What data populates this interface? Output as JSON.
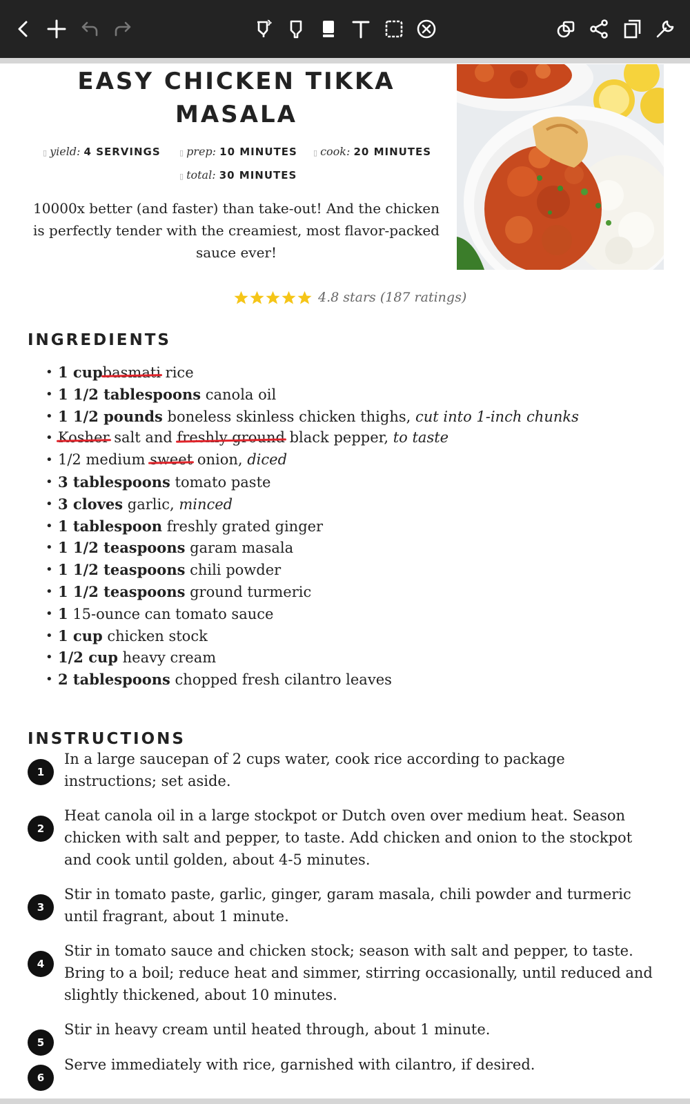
{
  "toolbar": {
    "left_icons": [
      "back-icon",
      "add-icon",
      "undo-icon",
      "redo-icon"
    ],
    "center_icons": [
      "pen-bluetooth-icon",
      "highlighter-icon",
      "eraser-icon",
      "text-icon",
      "lasso-select-icon",
      "clear-icon"
    ],
    "right_icons": [
      "shapes-icon",
      "share-icon",
      "pages-icon",
      "settings-wrench-icon"
    ],
    "background_color": "#232323"
  },
  "recipe": {
    "title_line1": "EASY CHICKEN TIKKA",
    "title_line2": "MASALA",
    "yield_label": "yield:",
    "yield_value": "4 SERVINGS",
    "prep_label": "prep:",
    "prep_value": "10 MINUTES",
    "cook_label": "cook:",
    "cook_value": "20 MINUTES",
    "total_label": "total:",
    "total_value": "30 MINUTES",
    "summary": "10000x better (and faster) than take-out! And the chicken is perfectly tender with the creamiest, most flavor-packed sauce ever!",
    "photo_alt_icon": "chicken-tikka-masala-photo",
    "rating": {
      "stars_shown": 5,
      "text": "4.8 stars (187 ratings)",
      "star_color": "#f5c518"
    }
  },
  "ingredients": {
    "heading": "INGREDIENTS",
    "items": [
      {
        "amount": "1 cup",
        "pre": "",
        "struck": "basmati",
        "text": " rice",
        "note": ""
      },
      {
        "amount": "1 1/2 tablespoons",
        "pre": "",
        "struck": "",
        "text": " canola oil",
        "note": ""
      },
      {
        "amount": "1 1/2 pounds",
        "pre": "",
        "struck": "",
        "text": " boneless skinless chicken thighs, ",
        "note": "cut into 1-inch chunks"
      },
      {
        "amount": "",
        "pre": "",
        "struck": "Kosher",
        "text": " salt and ",
        "struck2": "freshly ground",
        "text2": " black pepper, ",
        "note": "to taste"
      },
      {
        "amount": "",
        "pre": "1/2 medium ",
        "struck": "sweet",
        "text": " onion, ",
        "note": "diced"
      },
      {
        "amount": "3 tablespoons",
        "pre": "",
        "struck": "",
        "text": " tomato paste",
        "note": ""
      },
      {
        "amount": "3 cloves",
        "pre": "",
        "struck": "",
        "text": " garlic, ",
        "note": "minced"
      },
      {
        "amount": "1 tablespoon",
        "pre": "",
        "struck": "",
        "text": " freshly grated ginger",
        "note": ""
      },
      {
        "amount": "1 1/2 teaspoons",
        "pre": "",
        "struck": "",
        "text": " garam masala",
        "note": ""
      },
      {
        "amount": "1 1/2 teaspoons",
        "pre": "",
        "struck": "",
        "text": " chili powder",
        "note": ""
      },
      {
        "amount": "1 1/2 teaspoons",
        "pre": "",
        "struck": "",
        "text": " ground turmeric",
        "note": ""
      },
      {
        "amount": "1",
        "pre": "",
        "struck": "",
        "text": " 15-ounce can tomato sauce",
        "note": ""
      },
      {
        "amount": "1 cup",
        "pre": "",
        "struck": "",
        "text": " chicken stock",
        "note": ""
      },
      {
        "amount": "1/2 cup",
        "pre": "",
        "struck": "",
        "text": " heavy cream",
        "note": ""
      },
      {
        "amount": "2 tablespoons",
        "pre": "",
        "struck": "",
        "text": " chopped fresh cilantro leaves",
        "note": ""
      }
    ],
    "strike_color": "#e0242b"
  },
  "instructions": {
    "heading": "INSTRUCTIONS",
    "steps": [
      {
        "num": "1",
        "text": "In a large saucepan of 2 cups water, cook rice according to package instructions; set aside."
      },
      {
        "num": "2",
        "text": "Heat canola oil in a large stockpot or Dutch oven over medium heat. Season chicken with salt and pepper, to taste. Add chicken and onion to the stockpot and cook until golden, about 4-5 minutes."
      },
      {
        "num": "3",
        "text": "Stir in tomato paste, garlic, ginger, garam masala, chili powder and turmeric until fragrant, about 1 minute."
      },
      {
        "num": "4",
        "text": "Stir in tomato sauce and chicken stock; season with salt and pepper, to taste. Bring to a boil; reduce heat and simmer, stirring occasionally, until reduced and slightly thickened, about 10 minutes."
      },
      {
        "num": "5",
        "text": "Stir in heavy cream until heated through, about 1 minute."
      },
      {
        "num": "6",
        "text": "Serve immediately with rice, garnished with cilantro, if desired."
      }
    ]
  }
}
